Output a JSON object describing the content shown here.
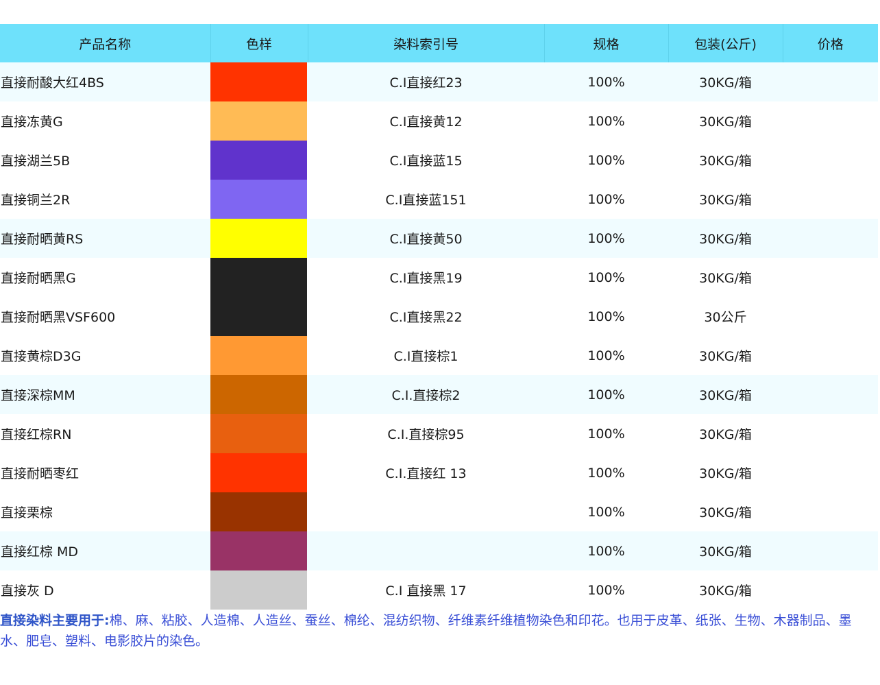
{
  "table": {
    "headers": [
      "产品名称",
      "色样",
      "染料索引号",
      "规格",
      "包装(公斤)",
      "价格"
    ],
    "rows": [
      {
        "name": "直接耐酸大红4BS",
        "color": "#ff3300",
        "ci": "C.I直接红23",
        "spec": "100%",
        "pack": "30KG/箱",
        "price": ""
      },
      {
        "name": "直接冻黄G",
        "color": "#ffbb55",
        "ci": "C.I直接黄12",
        "spec": "100%",
        "pack": "30KG/箱",
        "price": ""
      },
      {
        "name": "直接湖兰5B",
        "color": "#6033cc",
        "ci": "C.I直接蓝15",
        "spec": "100%",
        "pack": "30KG/箱",
        "price": ""
      },
      {
        "name": "直接铜兰2R",
        "color": "#7f66f2",
        "ci": "C.I直接蓝151",
        "spec": "100%",
        "pack": "30KG/箱",
        "price": ""
      },
      {
        "name": "直接耐晒黄RS",
        "color": "#ffff00",
        "ci": "C.I直接黄50",
        "spec": "100%",
        "pack": "30KG/箱",
        "price": ""
      },
      {
        "name": "直接耐晒黑G",
        "color": "#222222",
        "ci": "C.I直接黑19",
        "spec": "100%",
        "pack": "30KG/箱",
        "price": ""
      },
      {
        "name": "直接耐晒黑VSF600",
        "color": "#222222",
        "ci": "C.I直接黑22",
        "spec": "100%",
        "pack": "30公斤",
        "price": ""
      },
      {
        "name": "直接黄棕D3G",
        "color": "#ff9933",
        "ci": "C.I直接棕1",
        "spec": "100%",
        "pack": "30KG/箱",
        "price": ""
      },
      {
        "name": "直接深棕MM",
        "color": "#cc6600",
        "ci": "C.I.直接棕2",
        "spec": "100%",
        "pack": "30KG/箱",
        "price": ""
      },
      {
        "name": "直接红棕RN",
        "color": "#e8600f",
        "ci": "C.I.直接棕95",
        "spec": "100%",
        "pack": "30KG/箱",
        "price": ""
      },
      {
        "name": "直接耐晒枣红",
        "color": "#ff3300",
        "ci": "C.I.直接红 13",
        "spec": "100%",
        "pack": "30KG/箱",
        "price": ""
      },
      {
        "name": "直接栗棕",
        "color": "#993300",
        "ci": "",
        "spec": "100%",
        "pack": "30KG/箱",
        "price": ""
      },
      {
        "name": "直接红棕 MD",
        "color": "#993366",
        "ci": "",
        "spec": "100%",
        "pack": "30KG/箱",
        "price": ""
      },
      {
        "name": "直接灰 D",
        "color": "#cccccc",
        "ci": "C.I 直接黑 17",
        "spec": "100%",
        "pack": "30KG/箱",
        "price": ""
      }
    ]
  },
  "footnote": {
    "lead": "直接染料主要用于:",
    "text": "棉、麻、粘胶、人造棉、人造丝、蚕丝、棉纶、混纺织物、纤维素纤维植物染色和印花。也用于皮革、纸张、生物、木器制品、墨水、肥皂、塑料、电影胶片的染色。"
  },
  "colors": {
    "header_bg": "#6ee1fb",
    "row_shade": "#f0fcff",
    "footnote_text": "#3a4fd6"
  }
}
